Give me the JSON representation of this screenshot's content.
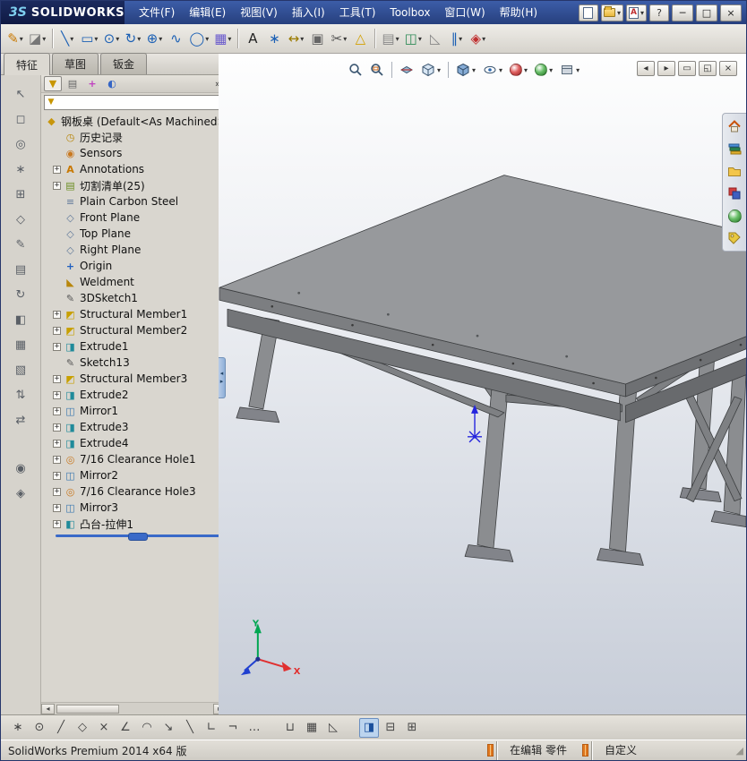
{
  "ui": {
    "caret": "▾",
    "chevrons": "»",
    "scroll_left": "◂",
    "scroll_right": "▸",
    "split_top": "◂",
    "split_bottom": "▸",
    "resize_grip": "◢"
  },
  "titlebar": {
    "logo_mark": "3S",
    "logo_text": "SOLIDWORKS",
    "menus": [
      "文件(F)",
      "编辑(E)",
      "视图(V)",
      "插入(I)",
      "工具(T)",
      "Toolbox",
      "窗口(W)",
      "帮助(H)"
    ],
    "help": "?",
    "window": {
      "minimize": "─",
      "maximize": "□",
      "close": "×"
    }
  },
  "tabs": {
    "items": [
      "特征",
      "草图",
      "钣金"
    ]
  },
  "toolbar": {
    "icons": [
      {
        "name": "sketch",
        "glyph": "✎",
        "style": "color:#c87800",
        "caret": "▾"
      },
      {
        "name": "eraser",
        "glyph": "◪",
        "style": "color:#777777",
        "caret": "▾"
      },
      {
        "name": "line",
        "glyph": "╲",
        "style": "color:#1a5fb4",
        "caret": "▾"
      },
      {
        "name": "rectangle",
        "glyph": "▭",
        "style": "color:#1a5fb4",
        "caret": "▾"
      },
      {
        "name": "slot",
        "glyph": "⊙",
        "style": "color:#1a5fb4",
        "caret": "▾"
      },
      {
        "name": "rotate",
        "glyph": "↻",
        "style": "color:#1a5fb4",
        "caret": "▾"
      },
      {
        "name": "circle",
        "glyph": "⊕",
        "style": "color:#1a5fb4",
        "caret": "▾"
      },
      {
        "name": "spline",
        "glyph": "∿",
        "style": "color:#1a5fb4",
        "caret": ""
      },
      {
        "name": "ellipse",
        "glyph": "◯",
        "style": "color:#1a5fb4",
        "caret": "▾"
      },
      {
        "name": "pattern",
        "glyph": "▦",
        "style": "color:#6a5acd",
        "caret": "▾"
      },
      {
        "name": "text",
        "glyph": "A",
        "style": "color:#222222",
        "caret": ""
      },
      {
        "name": "point",
        "glyph": "∗",
        "style": "color:#1a5fb4",
        "caret": ""
      },
      {
        "name": "dimension",
        "glyph": "↔",
        "style": "color:#9a7b00",
        "caret": "▾"
      },
      {
        "name": "copy",
        "glyph": "▣",
        "style": "color:#666666",
        "caret": ""
      },
      {
        "name": "trim",
        "glyph": "✂",
        "style": "color:#555555",
        "caret": "▾"
      },
      {
        "name": "warning",
        "glyph": "△",
        "style": "color:#d2a000",
        "caret": ""
      },
      {
        "name": "grid",
        "glyph": "▤",
        "style": "color:#888888",
        "caret": "▾"
      },
      {
        "name": "mirror",
        "glyph": "◫",
        "style": "color:#2e8b57",
        "caret": "▾"
      },
      {
        "name": "chamfer",
        "glyph": "◺",
        "style": "color:#888888",
        "caret": ""
      },
      {
        "name": "offset",
        "glyph": "∥",
        "style": "color:#1a5fb4",
        "caret": "▾"
      },
      {
        "name": "options",
        "glyph": "◈",
        "style": "color:#c03030",
        "caret": "▾"
      }
    ]
  },
  "left_toolbar": {
    "icons": [
      "↖",
      "◻",
      "◎",
      "∗",
      "⊞",
      "◇",
      "✎",
      "▤",
      "↻",
      "◧",
      "▦",
      "▧",
      "⇅",
      "⇄",
      "◉",
      "◈"
    ]
  },
  "panel": {
    "header_icons": [
      {
        "glyph": "▼",
        "style": "color:#c89600"
      },
      {
        "glyph": "▤",
        "style": "color:#666666"
      },
      {
        "glyph": "+",
        "style": "color:#c040c0;font-weight:bold"
      },
      {
        "glyph": "◐",
        "style": "color:#3565c5"
      }
    ],
    "root": {
      "glyph": "◆",
      "style": "color:#c8960c",
      "label": "钢板桌 (Default<As Machined>"
    },
    "items": [
      {
        "plus": "",
        "glyph": "◷",
        "style": "color:#b8860b",
        "label": "历史记录"
      },
      {
        "plus": "",
        "glyph": "◉",
        "style": "color:#c87820",
        "label": "Sensors"
      },
      {
        "plus": "+",
        "glyph": "A",
        "style": "color:#c87800;font-weight:bold",
        "label": "Annotations"
      },
      {
        "plus": "+",
        "glyph": "▤",
        "style": "color:#6b8e23",
        "label": "切割清单(25)"
      },
      {
        "plus": "",
        "glyph": "≡",
        "style": "color:#60799a",
        "label": "Plain Carbon Steel"
      },
      {
        "plus": "",
        "glyph": "◇",
        "style": "color:#60799a",
        "label": "Front Plane"
      },
      {
        "plus": "",
        "glyph": "◇",
        "style": "color:#60799a",
        "label": "Top Plane"
      },
      {
        "plus": "",
        "glyph": "◇",
        "style": "color:#60799a",
        "label": "Right Plane"
      },
      {
        "plus": "",
        "glyph": "+",
        "style": "color:#2060c0;font-weight:bold",
        "label": "Origin"
      },
      {
        "plus": "",
        "glyph": "◣",
        "style": "color:#b8860b",
        "label": "Weldment"
      },
      {
        "plus": "",
        "glyph": "✎",
        "style": "color:#555555",
        "label": "3DSketch1"
      },
      {
        "plus": "+",
        "glyph": "◩",
        "style": "color:#c8a000",
        "label": "Structural Member1"
      },
      {
        "plus": "+",
        "glyph": "◩",
        "style": "color:#c8a000",
        "label": "Structural Member2"
      },
      {
        "plus": "+",
        "glyph": "◨",
        "style": "color:#1f8a9a",
        "label": "Extrude1"
      },
      {
        "plus": "",
        "glyph": "✎",
        "style": "color:#555555",
        "label": "Sketch13"
      },
      {
        "plus": "+",
        "glyph": "◩",
        "style": "color:#c8a000",
        "label": "Structural Member3"
      },
      {
        "plus": "+",
        "glyph": "◨",
        "style": "color:#1f8a9a",
        "label": "Extrude2"
      },
      {
        "plus": "+",
        "glyph": "◫",
        "style": "color:#3a78b0",
        "label": "Mirror1"
      },
      {
        "plus": "+",
        "glyph": "◨",
        "style": "color:#1f8a9a",
        "label": "Extrude3"
      },
      {
        "plus": "+",
        "glyph": "◨",
        "style": "color:#1f8a9a",
        "label": "Extrude4"
      },
      {
        "plus": "+",
        "glyph": "◎",
        "style": "color:#c87820",
        "label": "7/16 Clearance Hole1"
      },
      {
        "plus": "+",
        "glyph": "◫",
        "style": "color:#3a78b0",
        "label": "Mirror2"
      },
      {
        "plus": "+",
        "glyph": "◎",
        "style": "color:#c87820",
        "label": "7/16 Clearance Hole3"
      },
      {
        "plus": "+",
        "glyph": "◫",
        "style": "color:#3a78b0",
        "label": "Mirror3"
      },
      {
        "plus": "+",
        "glyph": "◧",
        "style": "color:#1f8a9a",
        "label": "凸台-拉伸1"
      }
    ]
  },
  "viewport": {
    "headsup_icons": [
      "zoom-fit",
      "zoom-area",
      "section-view",
      "view-orientation",
      "display-style",
      "hide-show-items",
      "edit-appearance",
      "apply-scene",
      "view-settings"
    ],
    "window_buttons": [
      "◂",
      "▸",
      "▭",
      "◱",
      "×"
    ],
    "task_pane_icons": [
      "home",
      "design-library",
      "file-explorer",
      "view-palette",
      "appearances",
      "custom-properties"
    ],
    "triad": {
      "x": "X",
      "y": "Y"
    }
  },
  "bottom_toolbar": {
    "icons": [
      "∗",
      "⊙",
      "╱",
      "◇",
      "×",
      "∠",
      "◠",
      "↘",
      "╲",
      "∟",
      "¬",
      "…",
      "⊔",
      "▦",
      "◺",
      "◨",
      "⊟",
      "⊞"
    ]
  },
  "statusbar": {
    "left": "SolidWorks Premium 2014 x64 版",
    "editing": "在编辑 零件",
    "custom": "自定义"
  }
}
